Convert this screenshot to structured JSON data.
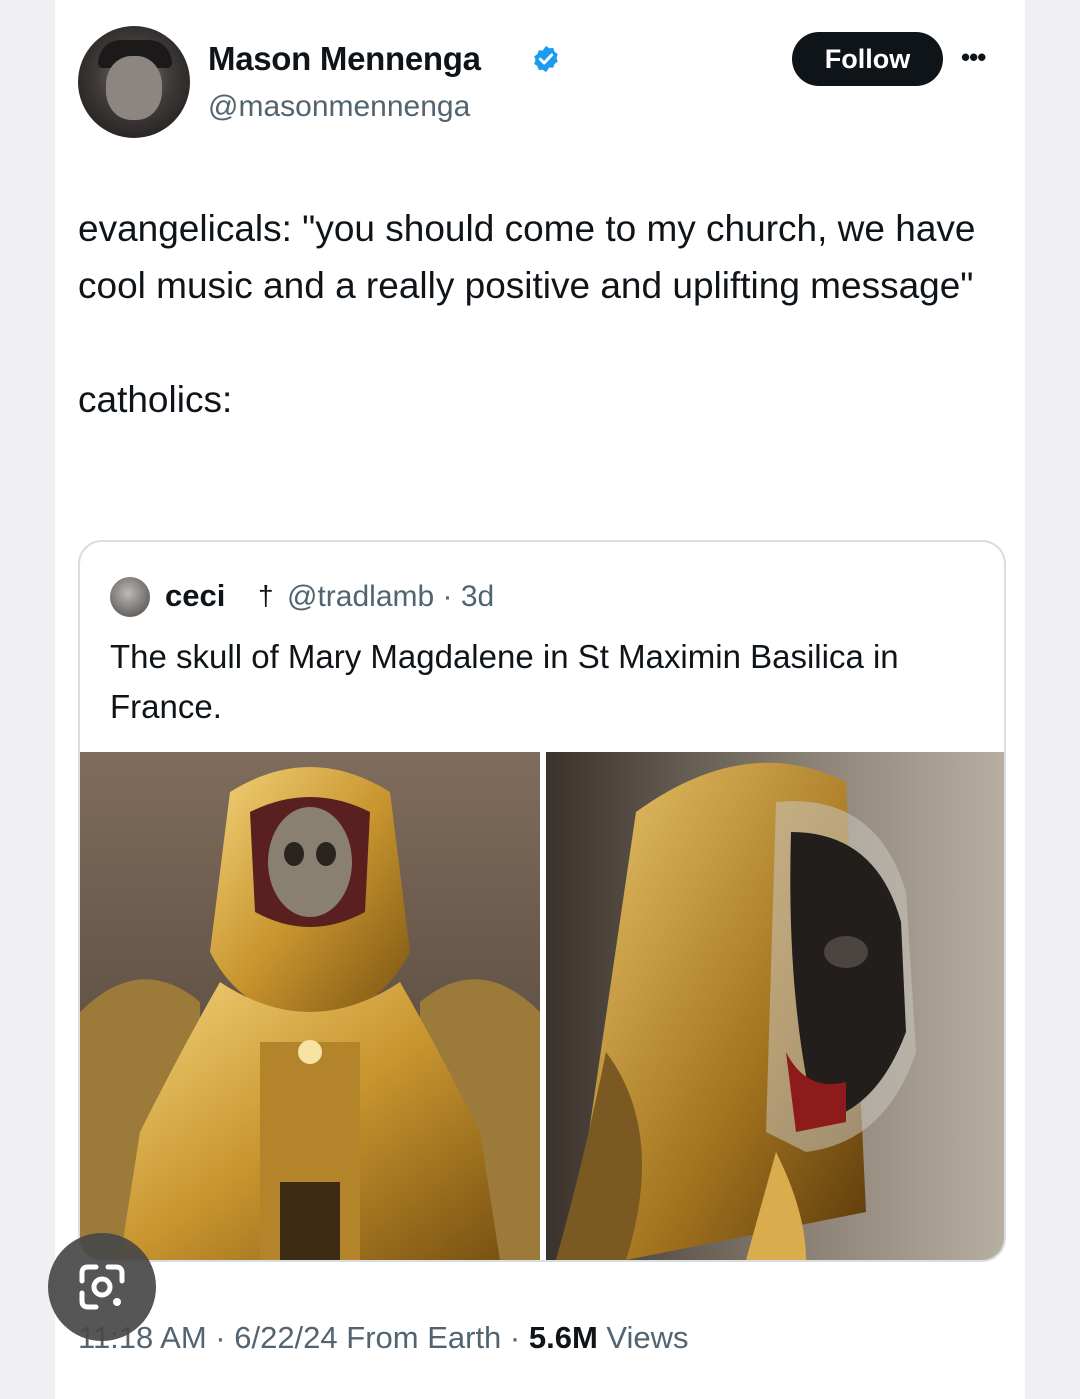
{
  "author": {
    "display_name": "Mason Mennenga",
    "handle": "@masonmennenga",
    "verified": true
  },
  "actions": {
    "follow_label": "Follow",
    "more_label": "•••"
  },
  "tweet": {
    "line1": "evangelicals: \"you should come to my church, we have cool music and a really positive and uplifting message\"",
    "line2": "catholics:"
  },
  "quote": {
    "display_name": "ceci",
    "cross": "†",
    "handle_time": "@tradlamb · 3d",
    "text": "The skull of Mary Magdalene in St Maximin Basilica in France."
  },
  "meta": {
    "time_date": "11:18 AM · 6/22/24 From Earth · ",
    "views_count": "5.6M",
    "views_label": " Views"
  },
  "icons": {
    "verified": "verified-badge-icon",
    "more": "ellipsis-icon",
    "lens": "google-lens-icon"
  },
  "colors": {
    "text_primary": "#0f1419",
    "text_secondary": "#536471",
    "verified_blue": "#1d9bf0",
    "button_bg": "#0f1419"
  }
}
